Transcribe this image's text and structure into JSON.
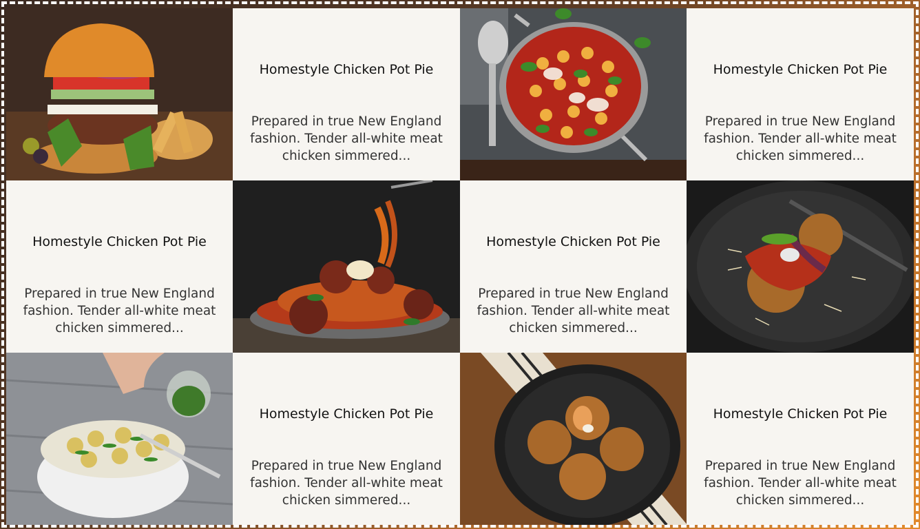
{
  "cards": [
    {
      "title": "Homestyle Chicken Pot Pie",
      "description": "Prepared in true New England fashion. Tender all-white meat chicken simmered..."
    },
    {
      "title": "Homestyle Chicken Pot Pie",
      "description": "Prepared in true New England fashion. Tender all-white meat chicken simmered..."
    },
    {
      "title": "Homestyle Chicken Pot Pie",
      "description": "Prepared in true New England fashion. Tender all-white meat chicken simmered..."
    },
    {
      "title": "Homestyle Chicken Pot Pie",
      "description": "Prepared in true New England fashion. Tender all-white meat chicken simmered..."
    },
    {
      "title": "Homestyle Chicken Pot Pie",
      "description": "Prepared in true New England fashion. Tender all-white meat chicken simmered..."
    },
    {
      "title": "Homestyle Chicken Pot Pie",
      "description": "Prepared in true New England fashion. Tender all-white meat chicken simmered..."
    }
  ],
  "photos": [
    "burger-photo",
    "gnocchi-pan-photo",
    "spaghetti-meatballs-photo",
    "arancini-plate-photo",
    "potato-salad-photo",
    "arancini-bowl-photo"
  ],
  "colors": {
    "card_bg": "#f7f5f1",
    "frame_accent": "#e28a2c"
  }
}
